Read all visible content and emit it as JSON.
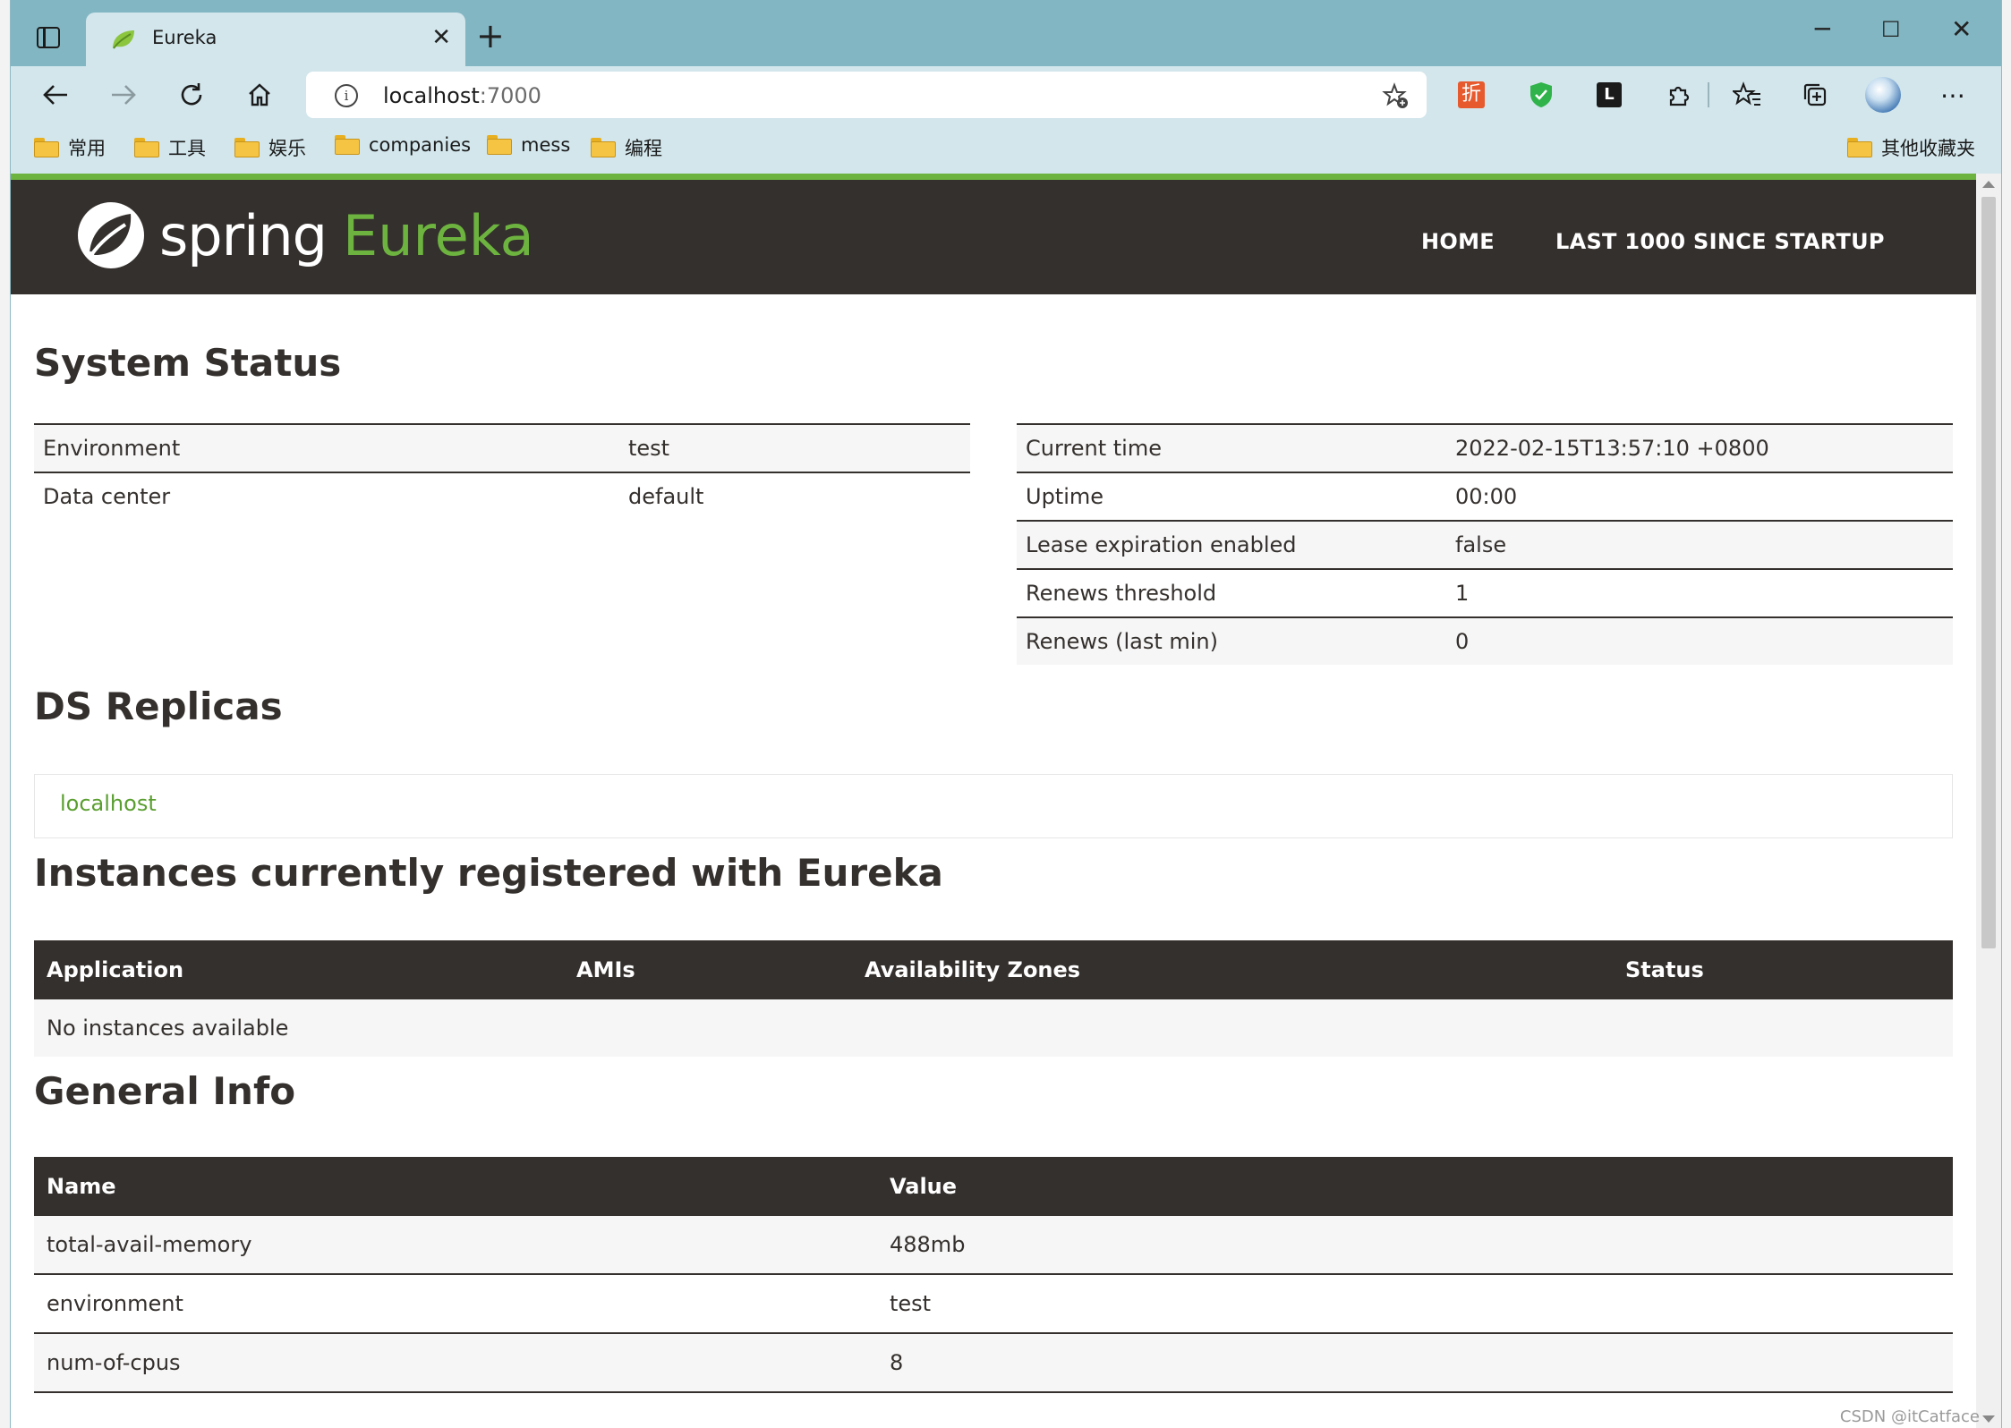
{
  "browser": {
    "tab_title": "Eureka",
    "url_host": "localhost",
    "url_port": ":7000",
    "bookmarks": [
      "常用",
      "工具",
      "娱乐",
      "companies",
      "mess",
      "编程"
    ],
    "other_bookmarks": "其他收藏夹",
    "ext_discount_label": "折"
  },
  "nav": {
    "logo_spring": "spring",
    "logo_eureka": "Eureka",
    "home": "HOME",
    "last1000": "LAST 1000 SINCE STARTUP"
  },
  "system_status": {
    "title": "System Status",
    "left": [
      {
        "key": "Environment",
        "value": "test"
      },
      {
        "key": "Data center",
        "value": "default"
      }
    ],
    "right": [
      {
        "key": "Current time",
        "value": "2022-02-15T13:57:10 +0800"
      },
      {
        "key": "Uptime",
        "value": "00:00"
      },
      {
        "key": "Lease expiration enabled",
        "value": "false"
      },
      {
        "key": "Renews threshold",
        "value": "1"
      },
      {
        "key": "Renews (last min)",
        "value": "0"
      }
    ]
  },
  "ds_replicas": {
    "title": "DS Replicas",
    "link": "localhost"
  },
  "instances": {
    "title": "Instances currently registered with Eureka",
    "headers": [
      "Application",
      "AMIs",
      "Availability Zones",
      "Status"
    ],
    "empty": "No instances available"
  },
  "general_info": {
    "title": "General Info",
    "headers": [
      "Name",
      "Value"
    ],
    "rows": [
      {
        "name": "total-avail-memory",
        "value": "488mb"
      },
      {
        "name": "environment",
        "value": "test"
      },
      {
        "name": "num-of-cpus",
        "value": "8"
      }
    ]
  },
  "watermark": "CSDN @itCatface",
  "colors": {
    "spring_green": "#6db33f",
    "navbar": "#34302d",
    "chrome": "#82b6c3",
    "toolbar": "#d2e6ec"
  }
}
